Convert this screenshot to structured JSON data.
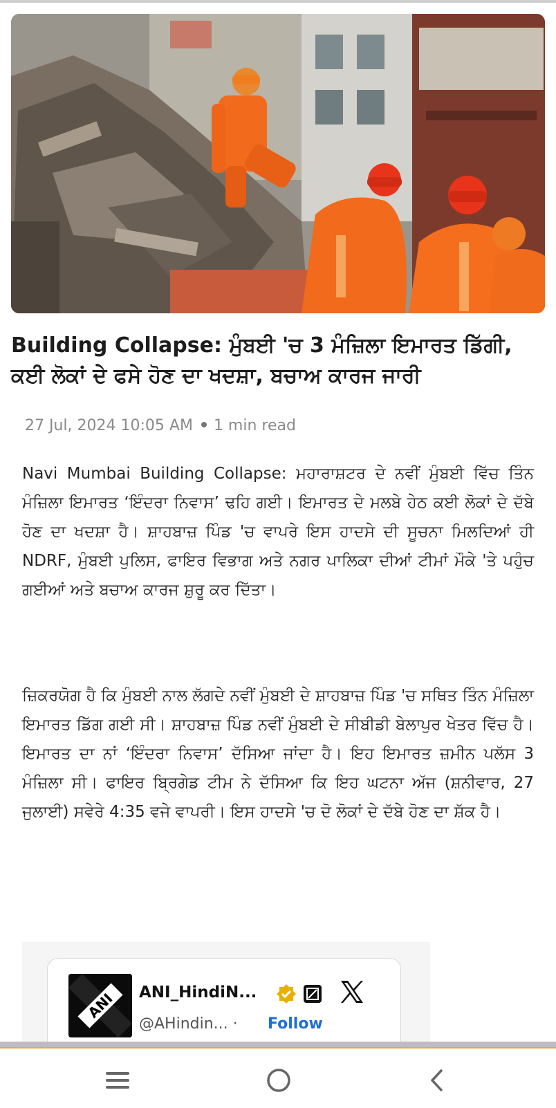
{
  "hero_image": {
    "alt": "Rescue workers in orange uniforms and helmets searching building rubble",
    "colors": {
      "uniform": "#f26a1b",
      "helmet": "#e83a1a",
      "rubble": "#7a6e62"
    }
  },
  "article": {
    "headline": "Building Collapse: ਮੁੰਬਈ 'ਚ 3 ਮੰਜ਼ਿਲਾ ਇਮਾਰਤ ਡਿੱਗੀ, ਕਈ ਲੋਕਾਂ ਦੇ ਫਸੇ ਹੋਣ ਦਾ ਖਦਸ਼ਾ, ਬਚਾਅ ਕਾਰਜ ਜਾਰੀ",
    "date": "27 Jul, 2024 10:05 AM",
    "read_time": "1 min read",
    "paragraphs": [
      "Navi Mumbai Building Collapse: ਮਹਾਰਾਸ਼ਟਰ ਦੇ ਨਵੀਂ ਮੁੰਬਈ ਵਿੱਚ ਤਿੰਨ ਮੰਜ਼ਿਲਾ ਇਮਾਰਤ ‘ਇੰਦਰਾ ਨਿਵਾਸ’ ਢਹਿ ਗਈ। ਇਮਾਰਤ ਦੇ ਮਲਬੇ ਹੇਠ ਕਈ ਲੋਕਾਂ ਦੇ ਦੱਬੇ ਹੋਣ ਦਾ ਖਦਸ਼ਾ ਹੈ। ਸ਼ਾਹਬਾਜ਼ ਪਿੰਡ 'ਚ ਵਾਪਰੇ ਇਸ ਹਾਦਸੇ ਦੀ ਸੂਚਨਾ ਮਿਲਦਿਆਂ ਹੀ NDRF, ਮੁੰਬਈ ਪੁਲਿਸ, ਫਾਇਰ ਵਿਭਾਗ ਅਤੇ ਨਗਰ ਪਾਲਿਕਾ ਦੀਆਂ ਟੀਮਾਂ ਮੌਕੇ 'ਤੇ ਪਹੁੰਚ ਗਈਆਂ ਅਤੇ ਬਚਾਅ ਕਾਰਜ ਸ਼ੁਰੂ ਕਰ ਦਿੱਤਾ।",
      "ਜ਼ਿਕਰਯੋਗ ਹੈ ਕਿ ਮੁੰਬਈ ਨਾਲ ਲੱਗਦੇ ਨਵੀਂ ਮੁੰਬਈ ਦੇ ਸ਼ਾਹਬਾਜ਼ ਪਿੰਡ 'ਚ ਸਥਿਤ ਤਿੰਨ ਮੰਜ਼ਿਲਾ ਇਮਾਰਤ ਡਿੱਗ ਗਈ ਸੀ। ਸ਼ਾਹਬਾਜ਼ ਪਿੰਡ ਨਵੀਂ ਮੁੰਬਈ ਦੇ ਸੀਬੀਡੀ ਬੇਲਾਪੁਰ ਖੇਤਰ ਵਿੱਚ ਹੈ। ਇਮਾਰਤ ਦਾ ਨਾਂ ‘ਇੰਦਰਾ ਨਿਵਾਸ’ ਦੱਸਿਆ ਜਾਂਦਾ ਹੈ। ਇਹ ਇਮਾਰਤ ਜ਼ਮੀਨ ਪਲੱਸ 3 ਮੰਜ਼ਿਲਾ ਸੀ। ਫਾਇਰ ਬ੍ਰਿਗੇਡ ਟੀਮ ਨੇ ਦੱਸਿਆ ਕਿ ਇਹ ਘਟਨਾ ਅੱਜ (ਸ਼ਨੀਵਾਰ, 27 ਜੁਲਾਈ) ਸਵੇਰੇ 4:35 ਵਜੇ ਵਾਪਰੀ। ਇਸ ਹਾਦਸੇ 'ਚ ਦੋ ਲੋਕਾਂ ਦੇ ਦੱਬੇ ਹੋਣ ਦਾ ਸ਼ੱਕ ਹੈ।"
    ]
  },
  "tweet_embed": {
    "display_name": "ANI_HindiN...",
    "handle": "@AHindin...",
    "separator": "·",
    "follow_label": "Follow",
    "logo_text": "ANI",
    "platform_icon": "x-logo-icon",
    "colors": {
      "follow": "#1d6fd8",
      "verified": "#e8b100"
    }
  },
  "navbar": {
    "icons": [
      "menu-icon",
      "home-circle-icon",
      "back-chevron-icon"
    ],
    "accent": "#f0a33a"
  }
}
